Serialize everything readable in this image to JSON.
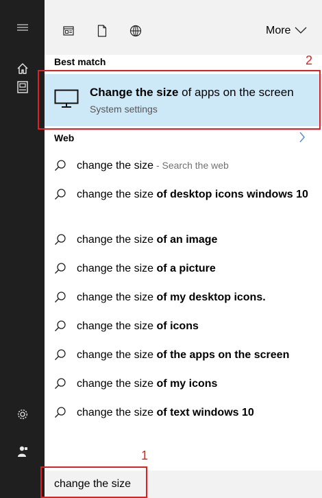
{
  "rail": {
    "icons": [
      "hamburger-icon",
      "home-icon",
      "tablet-icon",
      "gear-icon",
      "user-icon"
    ]
  },
  "toolbar": {
    "filters": [
      "apps-icon",
      "document-icon",
      "globe-icon"
    ],
    "more_label": "More"
  },
  "best_match": {
    "header": "Best match",
    "title_bold": "Change the size",
    "title_rest": " of apps on the screen",
    "subtitle": "System settings",
    "icon": "monitor-icon"
  },
  "web": {
    "header": "Web",
    "suggestions": [
      {
        "plain": "change the size",
        "bold": "",
        "hint": " - Search the web"
      },
      {
        "plain": "change the size ",
        "bold": "of desktop icons windows 10",
        "hint": ""
      },
      {
        "plain": "change the size ",
        "bold": "of an image",
        "hint": ""
      },
      {
        "plain": "change the size ",
        "bold": "of a picture",
        "hint": ""
      },
      {
        "plain": "change the size ",
        "bold": "of my desktop icons.",
        "hint": ""
      },
      {
        "plain": "change the size ",
        "bold": "of icons",
        "hint": ""
      },
      {
        "plain": "change the size ",
        "bold": "of the apps on the screen",
        "hint": ""
      },
      {
        "plain": "change the size ",
        "bold": "of my icons",
        "hint": ""
      },
      {
        "plain": "change the size ",
        "bold": "of text windows 10",
        "hint": ""
      }
    ]
  },
  "search": {
    "value": "change the size"
  },
  "annotations": {
    "marker_1": "1",
    "marker_2": "2",
    "color": "#e02020"
  },
  "colors": {
    "rail": "#1f1f1f",
    "best_match_highlight": "#cde8f6",
    "panel": "#f2f2f2"
  }
}
